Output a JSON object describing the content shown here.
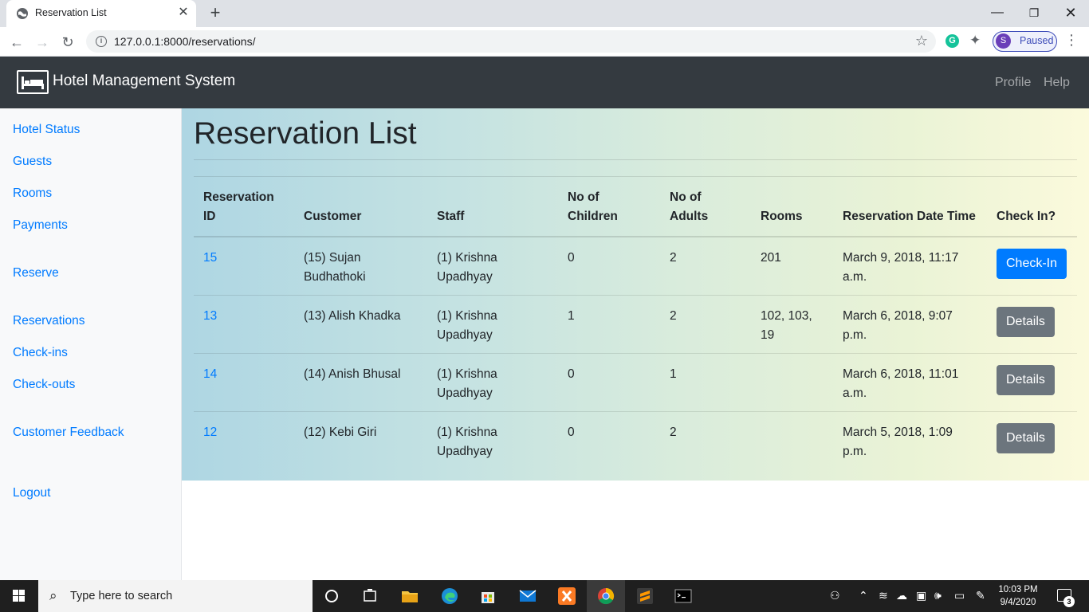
{
  "browser": {
    "tab_title": "Reservation List",
    "url": "127.0.0.1:8000/reservations/",
    "profile_initial": "S",
    "profile_status": "Paused"
  },
  "navbar": {
    "brand": "Hotel Management System",
    "links": [
      "Profile",
      "Help"
    ]
  },
  "sidebar": {
    "items": [
      {
        "label": "Hotel Status"
      },
      {
        "label": "Guests"
      },
      {
        "label": "Rooms"
      },
      {
        "label": "Payments"
      },
      {
        "label": "Reserve"
      },
      {
        "label": "Reservations"
      },
      {
        "label": "Check-ins"
      },
      {
        "label": "Check-outs"
      },
      {
        "label": "Customer Feedback"
      },
      {
        "label": "Logout"
      }
    ]
  },
  "main": {
    "title": "Reservation List",
    "columns": [
      "Reservation ID",
      "Customer",
      "Staff",
      "No of Children",
      "No of Adults",
      "Rooms",
      "Reservation Date Time",
      "Check In?"
    ],
    "rows": [
      {
        "id": "15",
        "customer": "(15) Sujan Budhathoki",
        "staff": "(1) Krishna Upadhyay",
        "children": "0",
        "adults": "2",
        "rooms": "201",
        "datetime": "March 9, 2018, 11:17 a.m.",
        "action": "Check-In",
        "action_style": "primary"
      },
      {
        "id": "13",
        "customer": "(13) Alish Khadka",
        "staff": "(1) Krishna Upadhyay",
        "children": "1",
        "adults": "2",
        "rooms": "102, 103, 19",
        "datetime": "March 6, 2018, 9:07 p.m.",
        "action": "Details",
        "action_style": "secondary"
      },
      {
        "id": "14",
        "customer": "(14) Anish Bhusal",
        "staff": "(1) Krishna Upadhyay",
        "children": "0",
        "adults": "1",
        "rooms": "",
        "datetime": "March 6, 2018, 11:01 a.m.",
        "action": "Details",
        "action_style": "secondary"
      },
      {
        "id": "12",
        "customer": "(12) Kebi Giri",
        "staff": "(1) Krishna Upadhyay",
        "children": "0",
        "adults": "2",
        "rooms": "",
        "datetime": "March 5, 2018, 1:09 p.m.",
        "action": "Details",
        "action_style": "secondary"
      }
    ]
  },
  "taskbar": {
    "search_placeholder": "Type here to search",
    "time": "10:03 PM",
    "date": "9/4/2020",
    "notification_count": "3"
  },
  "colors": {
    "link": "#007bff",
    "navbar_bg": "#343a40",
    "btn_primary": "#007bff",
    "btn_secondary": "#6c757d"
  }
}
